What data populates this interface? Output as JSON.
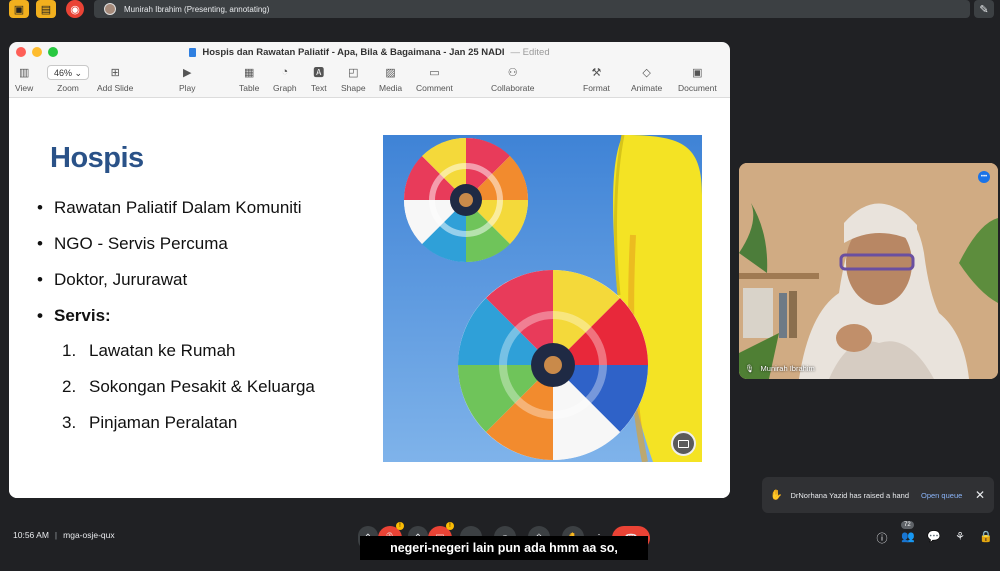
{
  "meet": {
    "presenter_text": "Munirah Ibrahim (Presenting, annotating)",
    "time": "10:56 AM",
    "meeting_code": "mga-osje-qux",
    "participant_count": "72",
    "caption": "negeri-negeri lain pun ada hmm aa so,",
    "notification": {
      "text": "DrNorhana Yazid has raised a hand",
      "action": "Open queue"
    },
    "tile_name": "Munirah Ibrahim"
  },
  "keynote": {
    "title": "Hospis dan Rawatan Paliatif - Apa, Bila & Bagaimana - Jan 25 NADI",
    "status": "Edited",
    "zoom": "46%",
    "tools": {
      "view": "View",
      "zoom": "Zoom",
      "add_slide": "Add Slide",
      "play": "Play",
      "table": "Table",
      "graph": "Graph",
      "text": "Text",
      "shape": "Shape",
      "media": "Media",
      "comment": "Comment",
      "collaborate": "Collaborate",
      "format": "Format",
      "animate": "Animate",
      "document": "Document"
    }
  },
  "slide": {
    "title": "Hospis",
    "bullets": [
      "Rawatan Paliatif Dalam Komuniti",
      "NGO - Servis Percuma",
      "Doktor, Jururawat",
      "Servis:"
    ],
    "subitems": [
      {
        "num": "1.",
        "text": "Lawatan ke Rumah"
      },
      {
        "num": "2.",
        "text": "Sokongan Pesakit & Keluarga"
      },
      {
        "num": "3.",
        "text": "Pinjaman Peralatan"
      }
    ]
  }
}
